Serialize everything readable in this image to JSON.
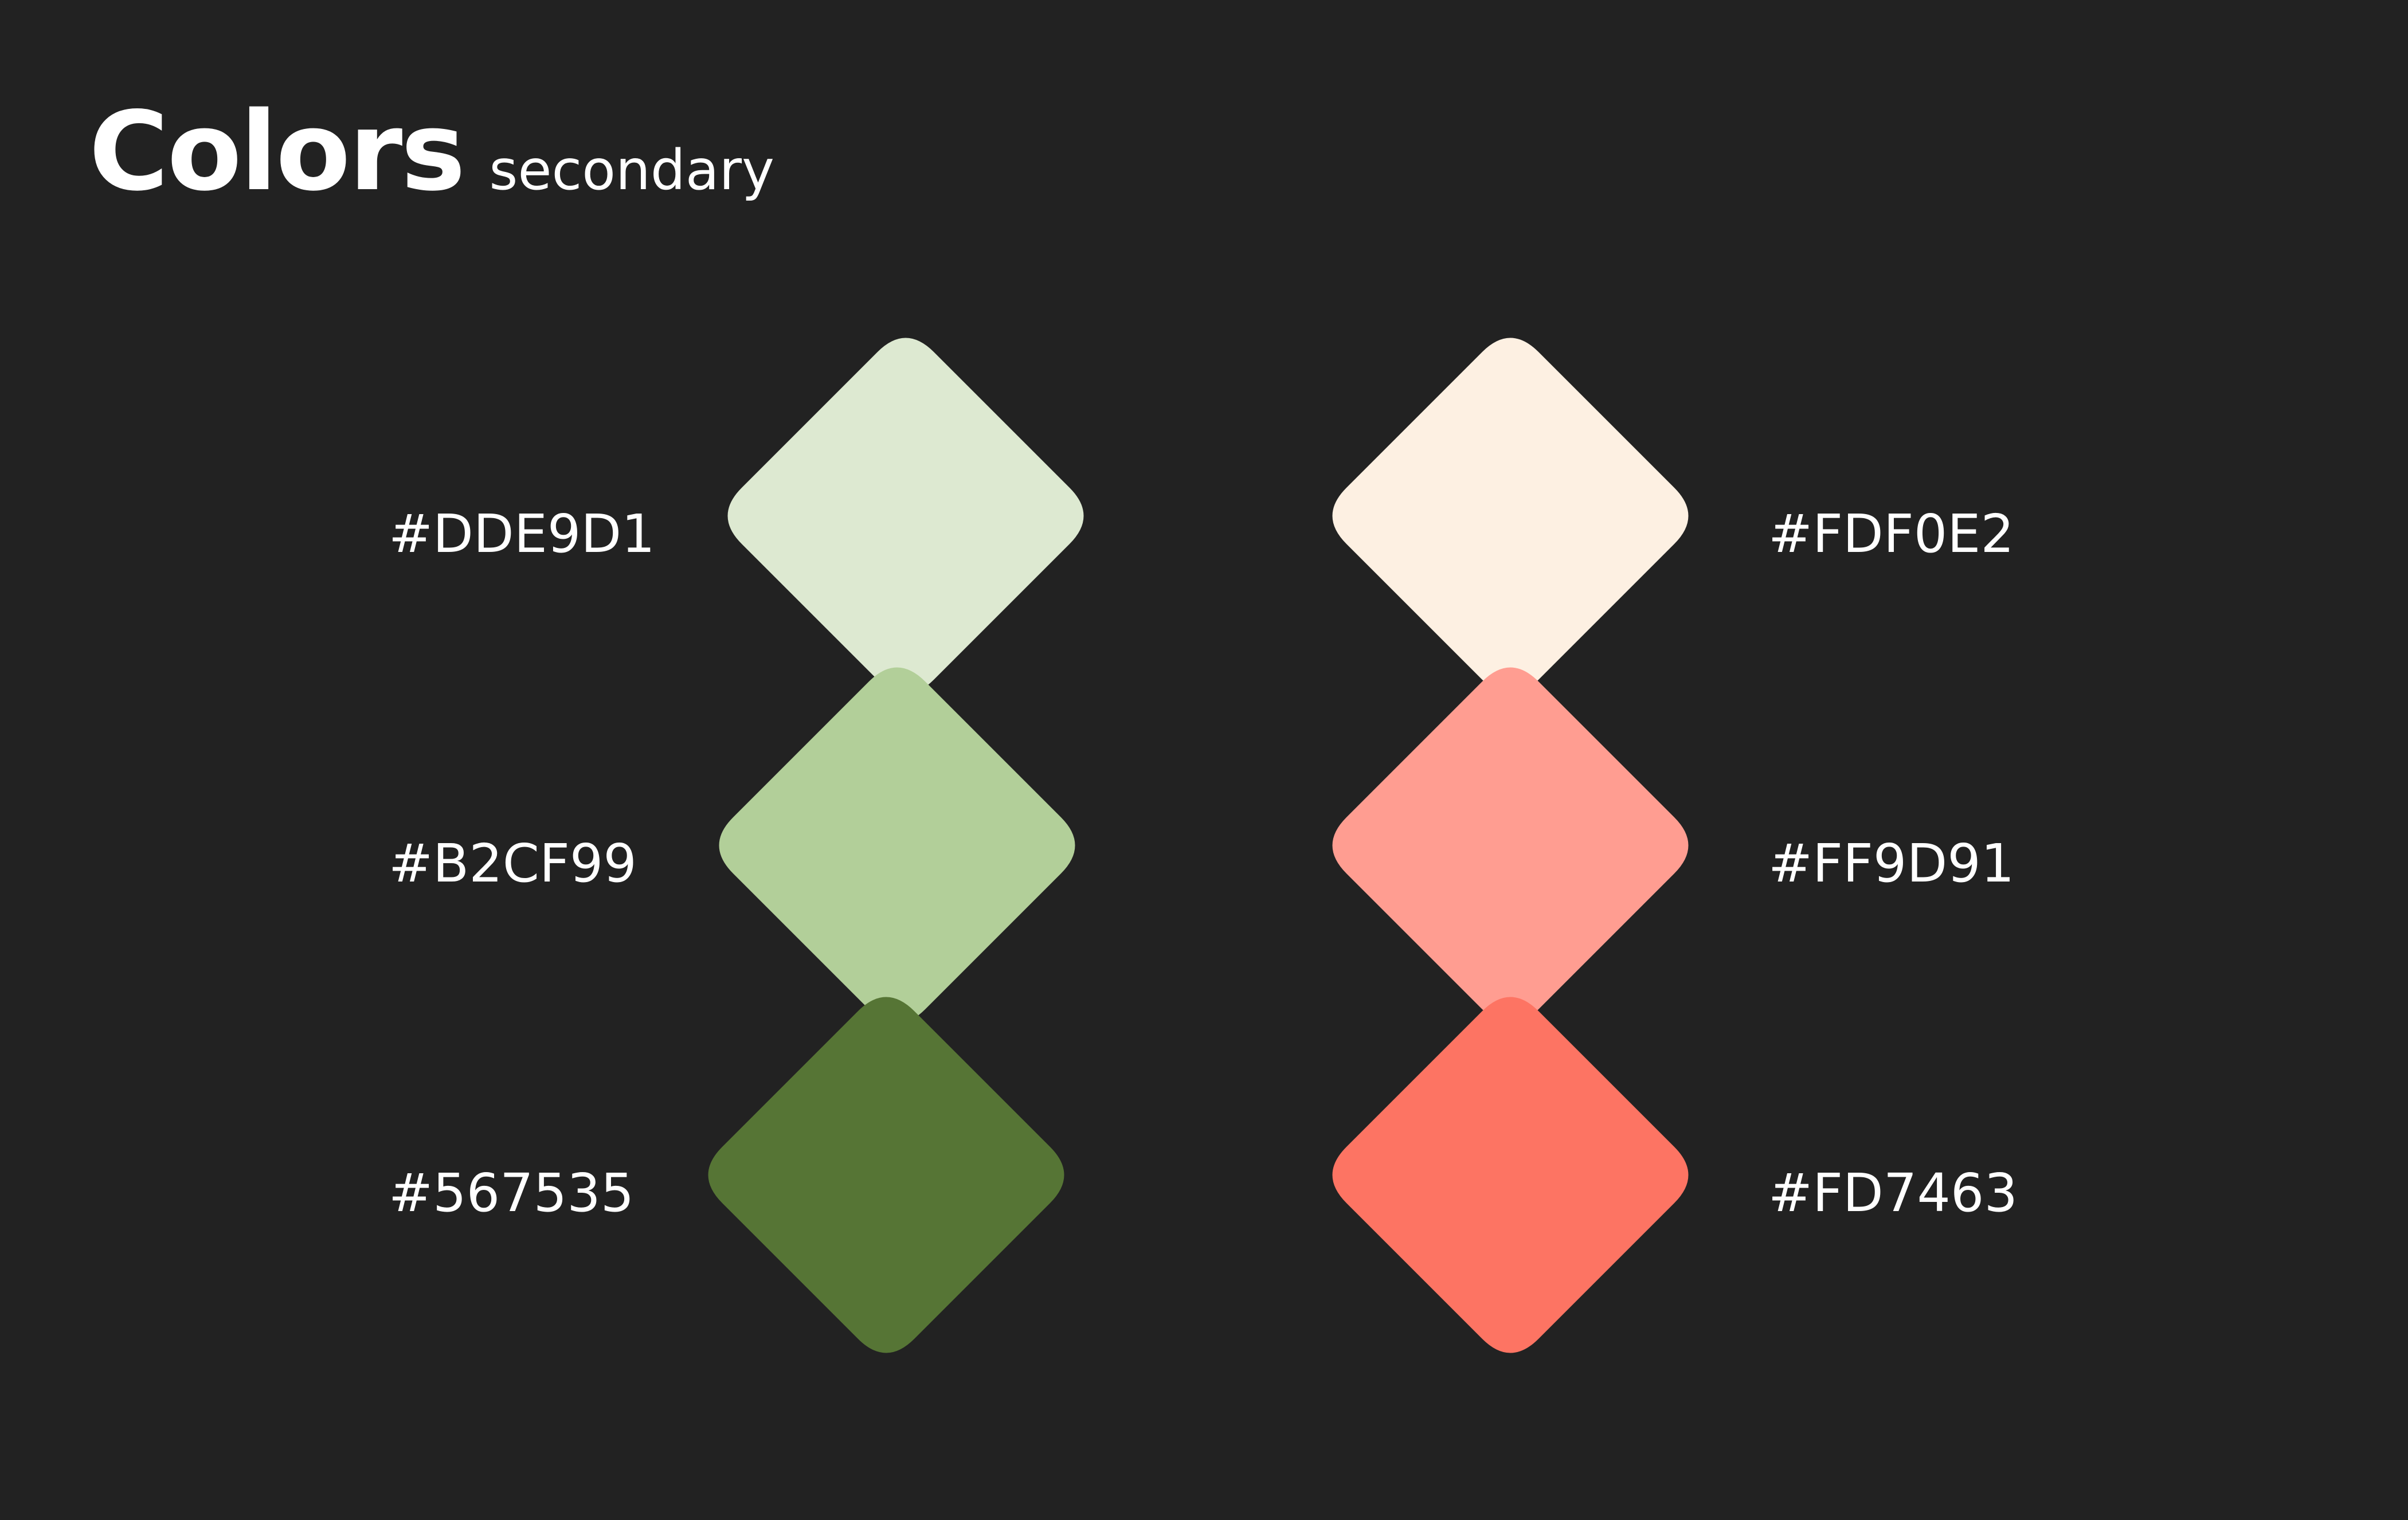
{
  "header": {
    "title": "Colors",
    "subtitle": "secondary"
  },
  "palette": {
    "left": [
      {
        "label": "#DDE9D1",
        "color": "#DDE9D1"
      },
      {
        "label": "#B2CF99",
        "color": "#B2CF99"
      },
      {
        "label": "#567535",
        "color": "#567535"
      }
    ],
    "right": [
      {
        "label": "#FDF0E2",
        "color": "#FDF0E2"
      },
      {
        "label": "#FF9D91",
        "color": "#FF9D91"
      },
      {
        "label": "#FD7463",
        "color": "#FD7463"
      }
    ]
  }
}
